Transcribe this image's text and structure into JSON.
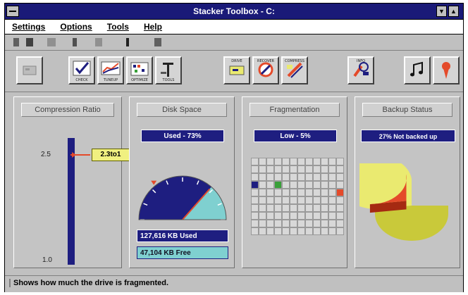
{
  "window": {
    "title": "Stacker Toolbox - C:"
  },
  "menu": [
    "Settings",
    "Options",
    "Tools",
    "Help"
  ],
  "toolbar": {
    "buttons": [
      {
        "name": "drive-icon"
      },
      {
        "name": "check-icon",
        "label": "CHECK"
      },
      {
        "name": "tuneup-icon",
        "label": "TUNEUP"
      },
      {
        "name": "optimize-icon",
        "label": "OPTIMIZE"
      },
      {
        "name": "tools-icon",
        "label": "TOOLS"
      },
      {
        "name": "drive-sm-icon",
        "label": "DRIVE"
      },
      {
        "name": "recover-icon",
        "label": "RECOVER"
      },
      {
        "name": "compress-icon",
        "label": "COMPRESS"
      },
      {
        "name": "info-icon",
        "label": "INFO"
      },
      {
        "name": "music-icon"
      },
      {
        "name": "map-pin-icon"
      }
    ]
  },
  "panels": {
    "compression": {
      "title": "Compression Ratio",
      "tick_top": "2.5",
      "tick_bottom": "1.0",
      "value_label": "2.3to1",
      "value": 2.3,
      "min": 1.0,
      "max": 2.5
    },
    "disk": {
      "title": "Disk Space",
      "used_pct_label": "Used - 73%",
      "used_fraction": 0.73,
      "used_label": "127,616 KB Used",
      "free_label": "47,104 KB Free"
    },
    "fragmentation": {
      "title": "Fragmentation",
      "status_label": "Low - 5%",
      "rows": 10,
      "cols": 12
    },
    "backup": {
      "title": "Backup Status",
      "status_label": "27% Not backed up",
      "not_backed_fraction": 0.27
    }
  },
  "status": {
    "text": "Shows how much the drive is fragmented."
  },
  "colors": {
    "navy": "#1e1e80",
    "teal": "#7fd0d0",
    "pie_yellow": "#eaea70",
    "pie_red": "#e44a2a"
  }
}
